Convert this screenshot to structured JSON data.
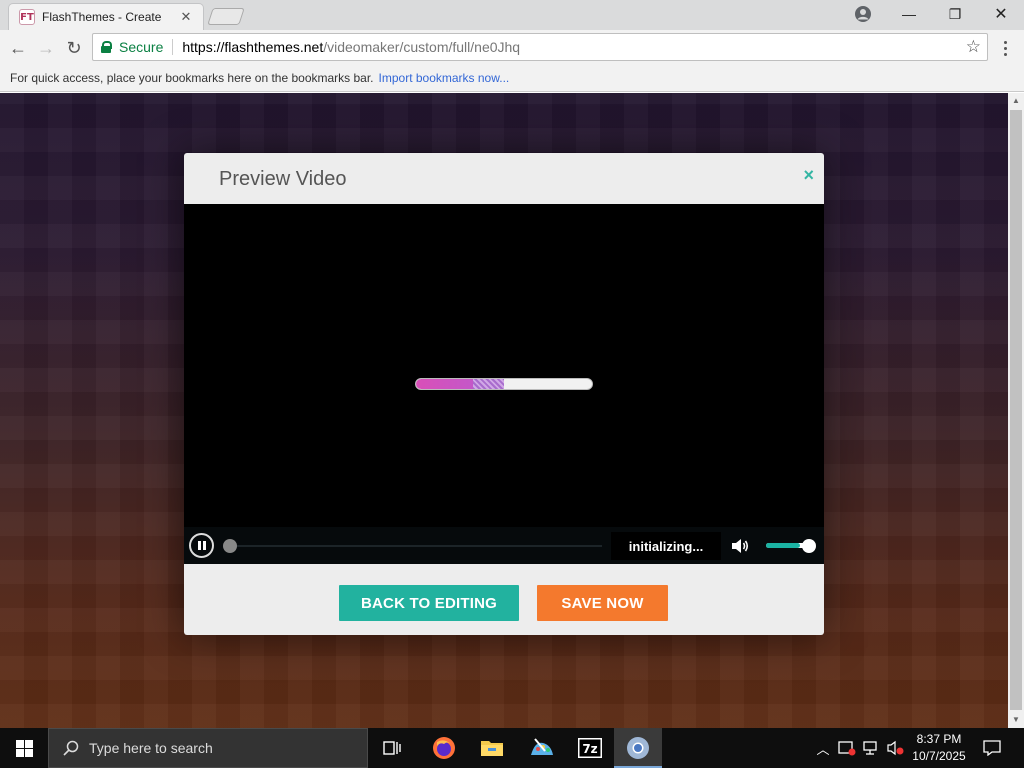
{
  "browser": {
    "tab": {
      "title": "FlashThemes - Create",
      "favicon_text": "FT",
      "close": "✕"
    },
    "window_controls": {
      "minimize": "—",
      "maximize": "❐",
      "close": "✕"
    },
    "nav": {
      "back": "←",
      "forward": "→",
      "reload": "↻"
    },
    "address": {
      "security_label": "Secure",
      "url_host": "https://flashthemes.net",
      "url_path": "/videomaker/custom/full/ne0Jhq",
      "star": "☆"
    },
    "bookmarks_bar": {
      "message": "For quick access, place your bookmarks here on the bookmarks bar.",
      "import_link": "Import bookmarks now..."
    }
  },
  "modal": {
    "title": "Preview Video",
    "close": "×",
    "player": {
      "load_progress": 0.5,
      "status_text": "initializing...",
      "volume": 0.78
    },
    "buttons": {
      "back": "BACK TO EDITING",
      "save": "SAVE NOW"
    }
  },
  "taskbar": {
    "search_placeholder": "Type here to search",
    "clock_time": "8:37 PM",
    "clock_date": "10/7/2025",
    "apps": [
      "task-view",
      "firefox",
      "file-explorer",
      "paint",
      "7zip",
      "chrome"
    ]
  },
  "colors": {
    "teal": "#22b29f",
    "orange": "#f4792d",
    "load_pink": "#d94fb8",
    "secure_green": "#0b8043"
  }
}
